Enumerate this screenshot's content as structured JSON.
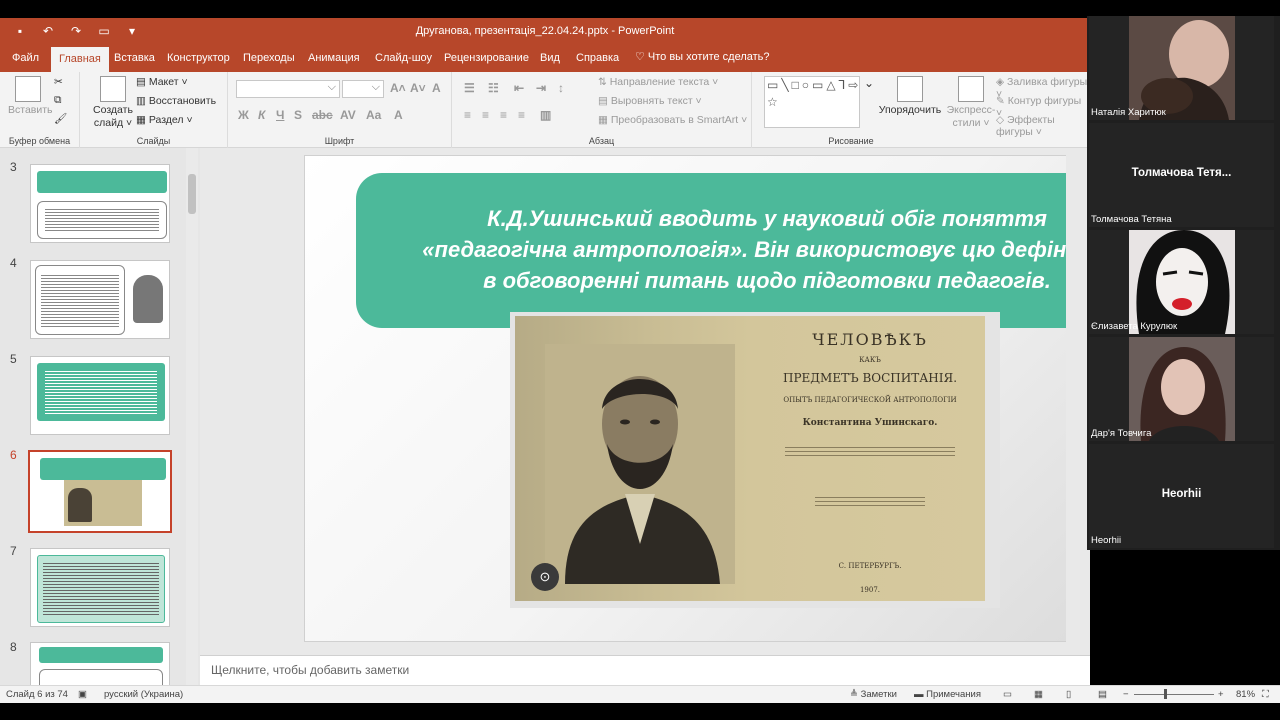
{
  "window": {
    "title": "Друганова, презентація_22.04.24.pptx  -  PowerPoint"
  },
  "tabs": [
    "Файл",
    "Главная",
    "Вставка",
    "Конструктор",
    "Переходы",
    "Анимация",
    "Слайд-шоу",
    "Рецензирование",
    "Вид",
    "Справка"
  ],
  "tellme": "Что вы хотите сделать?",
  "ribbon": {
    "clipboard": {
      "label": "Буфер обмена",
      "paste": "Вставить"
    },
    "slides": {
      "label": "Слайды",
      "new_slide_1": "Создать",
      "new_slide_2": "слайд ˅",
      "layout": "Макет ˅",
      "reset": "Восстановить",
      "section": "Раздел ˅"
    },
    "font": {
      "label": "Шрифт"
    },
    "paragraph": {
      "label": "Абзац",
      "text_direction": "Направление текста ˅",
      "align_text": "Выровнять текст ˅",
      "smartart": "Преобразовать в SmartArt ˅"
    },
    "drawing": {
      "label": "Рисование",
      "arrange": "Упорядочить",
      "quick_styles_1": "Экспресс-",
      "quick_styles_2": "стили ˅",
      "fill": "Заливка фигуры ˅",
      "outline": "Контур фигуры ˅",
      "effects": "Эффекты фигуры ˅"
    }
  },
  "thumbnails": [
    {
      "num": "3"
    },
    {
      "num": "4"
    },
    {
      "num": "5"
    },
    {
      "num": "6"
    },
    {
      "num": "7"
    },
    {
      "num": "8"
    }
  ],
  "slide": {
    "line1": "К.Д.Ушинський вводить у науковий обіг поняття",
    "line2": "«педагогічна антропологія». Він використовує цю дефініцію",
    "line3": "в обговоренні питань щодо підготовки педагогів.",
    "book": {
      "title1": "ЧЕЛОВѢКЪ",
      "small1": "КАКЪ",
      "title2": "ПРЕДМЕТЪ ВОСПИТАНІЯ.",
      "subtitle": "ОПЫТЪ ПЕДАГОГИЧЕСКОЙ АНТРОПОЛОГІИ",
      "author": "Константина Ушинскаго.",
      "place": "С. ПЕТЕРБУРГЪ.",
      "year": "1907."
    }
  },
  "notes_placeholder": "Щелкните, чтобы добавить заметки",
  "status": {
    "slide_info": "Слайд 6 из 74",
    "language": "русский (Украина)",
    "notes": "Заметки",
    "comments": "Примечания",
    "zoom": "81%"
  },
  "participants": [
    {
      "name": "Наталія Харитюк",
      "display": ""
    },
    {
      "name": "Толмачова Тетяна",
      "display": "Толмачова  Тетя..."
    },
    {
      "name": "Єлизавета Курулюк",
      "display": ""
    },
    {
      "name": "Дар'я Товчига",
      "display": ""
    },
    {
      "name": "Heorhii",
      "display": "Heorhii"
    }
  ],
  "colors": {
    "accent": "#b7472a",
    "slide_teal": "#4cb99a"
  }
}
